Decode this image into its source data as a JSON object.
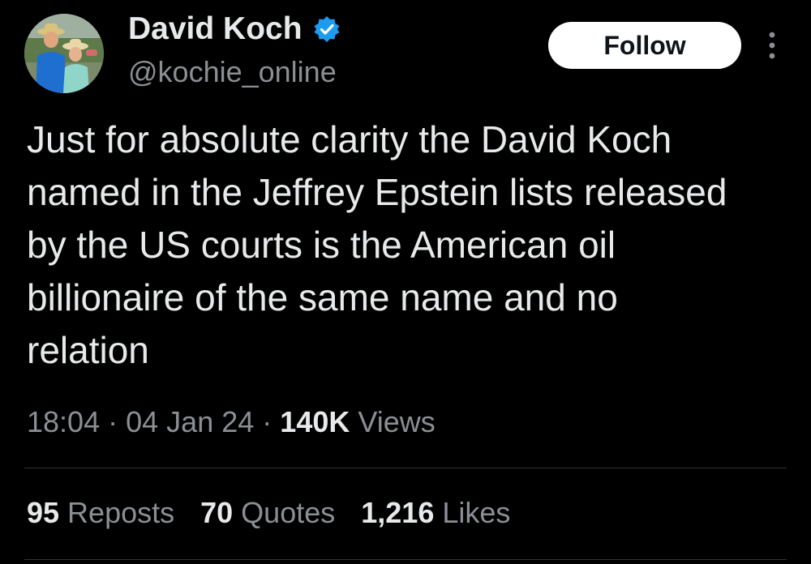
{
  "tweet": {
    "author": {
      "name": "David Koch",
      "handle": "@kochie_online",
      "verified_color": "#1d9bf0"
    },
    "follow_label": "Follow",
    "text": "Just for absolute clarity the David Koch named in the Jeffrey Epstein lists released by the US courts is the American oil billionaire of the same name and no relation",
    "time": "18:04",
    "date": "04 Jan 24",
    "sep": "·",
    "views_count": "140K",
    "views_label": "Views",
    "stats": {
      "reposts_count": "95",
      "reposts_label": "Reposts",
      "quotes_count": "70",
      "quotes_label": "Quotes",
      "likes_count": "1,216",
      "likes_label": "Likes"
    }
  },
  "icons": {
    "verified": "verified-badge-icon",
    "more": "more-options-icon"
  },
  "colors": {
    "background": "#000000",
    "text_primary": "#e7e9ea",
    "text_secondary": "#8b8f94",
    "divider": "#2f3336",
    "follow_bg": "#ffffff"
  }
}
